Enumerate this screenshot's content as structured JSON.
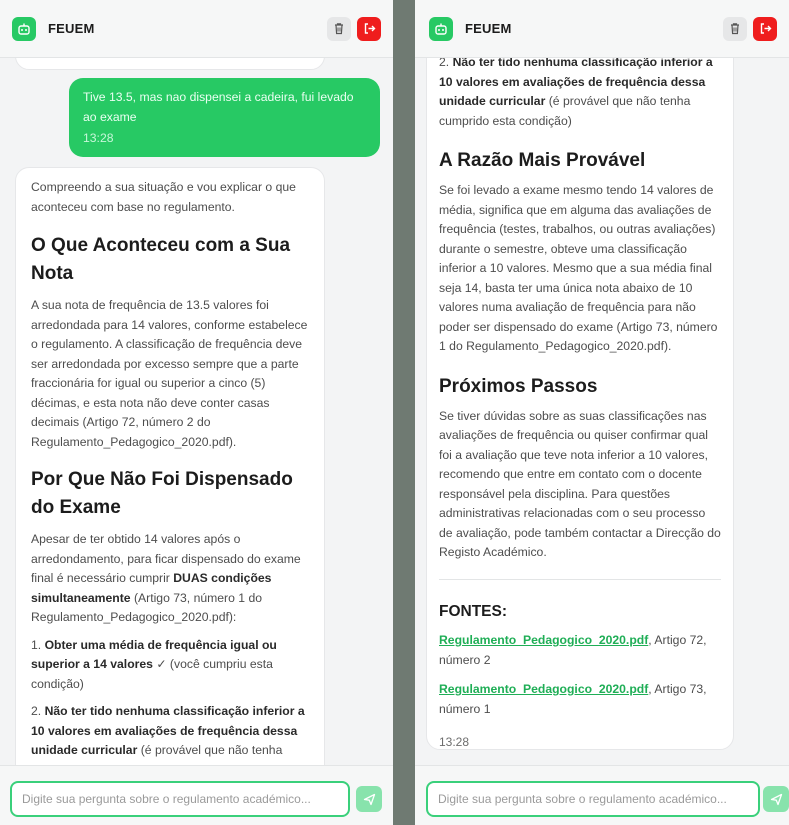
{
  "app": {
    "brand": "FEUEM"
  },
  "colors": {
    "accent": "#27c964",
    "danger": "#ef1d1d",
    "divider": "#6f7a72"
  },
  "icons": {
    "logo": "robot-icon",
    "clear": "trash-icon",
    "logout": "logout-icon",
    "send": "send-icon"
  },
  "composer": {
    "placeholder": "Digite sua pergunta sobre o regulamento académico..."
  },
  "user_message": {
    "text": "Tive 13.5, mas nao dispensei a cadeira, fui levado ao exame",
    "time": "13:28"
  },
  "bot_message": {
    "intro": "Compreendo a sua situação e vou explicar o que aconteceu com base no regulamento.",
    "h_nota_1": "O Que Aconteceu com a Sua",
    "h_nota_2": "Nota",
    "p_nota": "A sua nota de frequência de 13.5 valores foi arredondada para 14 valores, conforme estabelece o regulamento. A classificação de frequência deve ser arredondada por excesso sempre que a parte fraccionária for igual ou superior a cinco (5) décimas, e esta nota não deve conter casas decimais (Artigo 72, número 2 do Regulamento_Pedagogico_2020.pdf).",
    "h_disp_1": "Por Que Não Foi Dispensado",
    "h_disp_2": "do Exame",
    "p_disp_a": "Apesar de ter obtido 14 valores após o arredondamento, para ficar dispensado do exame final é necessário cumprir ",
    "p_disp_b": "DUAS condições simultaneamente",
    "p_disp_c": " (Artigo 73, número 1 do Regulamento_Pedagogico_2020.pdf):",
    "c1_num": "1. ",
    "c1_bold": "Obter uma média de frequência igual ou superior a 14 valores",
    "c1_rest": " ✓ (você cumpriu esta condição)",
    "c2_num": "2. ",
    "c2_bold": "Não ter tido nenhuma classificação inferior a 10 valores em avaliações de frequência dessa unidade curricular",
    "c2_rest": " (é provável que não tenha cumprido esta condição)",
    "h_razao": "A Razão Mais Provável",
    "p_razao": "Se foi levado a exame mesmo tendo 14 valores de média, significa que em alguma das avaliações de frequência (testes, trabalhos, ou outras avaliações) durante o semestre, obteve uma classificação inferior a 10 valores. Mesmo que a sua média final seja 14, basta ter uma única nota abaixo de 10 valores numa avaliação de frequência para não poder ser dispensado do exame (Artigo 73, número 1 do Regulamento_Pedagogico_2020.pdf).",
    "h_passos": "Próximos Passos",
    "p_passos": "Se tiver dúvidas sobre as suas classificações nas avaliações de frequência ou quiser confirmar qual foi a avaliação que teve nota inferior a 10 valores, recomendo que entre em contato com o docente responsável pela disciplina. Para questões administrativas relacionadas com o seu processo de avaliação, pode também contactar a Direcção do Registo Académico.",
    "h_fontes": "FONTES:",
    "src1_link": "Regulamento_Pedagogico_2020.pdf",
    "src1_rest": ", Artigo 72, número 2",
    "src2_link": "Regulamento_Pedagogico_2020.pdf",
    "src2_rest": ", Artigo 73, número 1",
    "time": "13:28"
  }
}
